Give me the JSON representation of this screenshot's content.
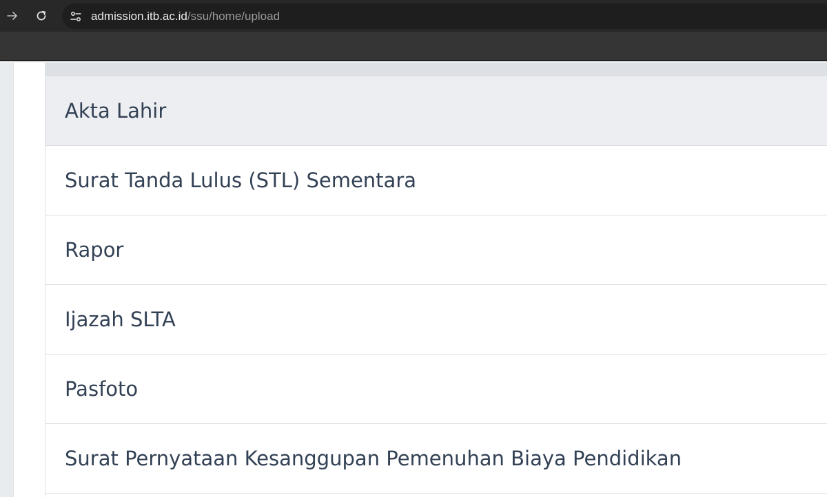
{
  "browser": {
    "url_host": "admission.itb.ac.id",
    "url_path": "/ssu/home/upload",
    "icons": {
      "forward": "arrow-right-icon",
      "reload": "reload-icon",
      "site_info": "tune-icon"
    }
  },
  "documents": {
    "items": [
      {
        "label": "Akta Lahir"
      },
      {
        "label": "Surat Tanda Lulus (STL) Sementara"
      },
      {
        "label": "Rapor"
      },
      {
        "label": "Ijazah SLTA"
      },
      {
        "label": "Pasfoto"
      },
      {
        "label": "Surat Pernyataan Kesanggupan Pemenuhan Biaya Pendidikan"
      }
    ],
    "active_index": 0
  },
  "colors": {
    "chrome_bg": "#282828",
    "omnibox_bg": "#1e1e1e",
    "item_text": "#334155",
    "active_bg": "#eceef1"
  }
}
